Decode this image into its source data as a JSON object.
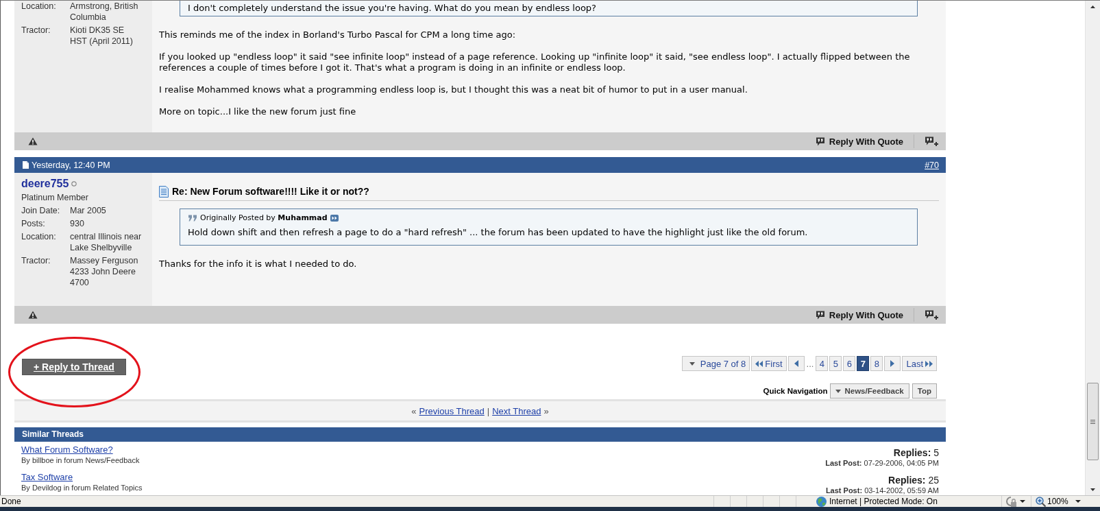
{
  "posts": [
    {
      "user": {
        "fields": [
          {
            "label": "Location:",
            "value": "Armstrong, British Columbia"
          },
          {
            "label": "Tractor:",
            "value": "Kioti DK35 SE HST (April 2011)"
          }
        ]
      },
      "quote": {
        "text": "I don't completely understand the issue you're having. What do you mean by endless loop?"
      },
      "paragraphs": [
        "This reminds me of the index in Borland's Turbo Pascal for CPM a long time ago:",
        "If you looked up \"endless loop\" it said \"see infinite loop\" instead of a page reference. Looking up \"infinite loop\" it said, \"see endless loop\". I actually flipped between the references a couple of times before I got it. That's what a program is doing in an infinite or endless loop.",
        "I realise Mohammed knows what a programming endless loop is, but I thought this was a neat bit of humor to put in a user manual.",
        "More on topic...I like the new forum just fine"
      ],
      "footer": {
        "action": "Reply With Quote"
      }
    },
    {
      "header": {
        "date": "Yesterday, 12:40 PM",
        "number": "#70"
      },
      "user": {
        "name": "deere755",
        "online": false,
        "rank": "Platinum Member",
        "fields": [
          {
            "label": "Join Date:",
            "value": "Mar 2005"
          },
          {
            "label": "Posts:",
            "value": "930"
          },
          {
            "label": "Location:",
            "value": "central Illinois near Lake Shelbyville"
          },
          {
            "label": "Tractor:",
            "value": "Massey Ferguson 4233 John Deere 4700"
          }
        ]
      },
      "title": "Re: New Forum software!!!! Like it or not??",
      "quote": {
        "attribution": "Originally Posted by **Muhammad**",
        "text": "Hold down shift and then refresh a page to do a \"hard refresh\" ... the forum has been updated to have the highlight just like the old forum."
      },
      "paragraphs": [
        "Thanks for the info it is what I needed to do."
      ],
      "footer": {
        "action": "Reply With Quote"
      }
    }
  ],
  "reply_button": "+ Reply to Thread",
  "pagination": {
    "menu": "Page 7 of 8",
    "first": "First",
    "ellipsis": "...",
    "pages": [
      {
        "label": "4",
        "selected": false
      },
      {
        "label": "5",
        "selected": false
      },
      {
        "label": "6",
        "selected": false
      },
      {
        "label": "7",
        "selected": true
      },
      {
        "label": "8",
        "selected": false
      }
    ],
    "last": "Last"
  },
  "quick_navigation": {
    "label": "Quick Navigation",
    "menu": "News/Feedback",
    "top": "Top"
  },
  "thread_nav": {
    "left_mark": "«",
    "previous": "Previous Thread",
    "separator": "|",
    "next": "Next Thread",
    "right_mark": "»"
  },
  "similar_threads": {
    "title": "Similar Threads",
    "items": [
      {
        "title": "What Forum Software?",
        "byline": "By billboe in forum News/Feedback",
        "replies": "**Replies:** 5",
        "last_post": "**Last Post:** 07-29-2006, 04:05 PM"
      },
      {
        "title": "Tax Software",
        "byline": "By Devildog in forum Related Topics",
        "replies": "**Replies:** 25",
        "last_post": "**Last Post:** 03-14-2002, 05:59 AM"
      }
    ]
  },
  "status_bar": {
    "text": "Done",
    "zone": "Internet | Protected Mode: On",
    "zoom": "100%"
  }
}
